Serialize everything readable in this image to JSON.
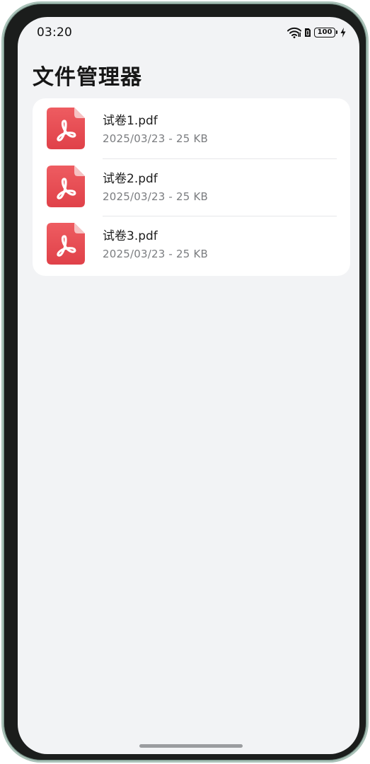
{
  "status_bar": {
    "time": "03:20",
    "battery_level": "100",
    "icons": [
      "wifi-icon",
      "sim-icon",
      "battery-icon",
      "charging-icon"
    ]
  },
  "app": {
    "title": "文件管理器"
  },
  "files": [
    {
      "name": "试卷1.pdf",
      "meta": "2025/03/23 - 25 KB",
      "icon": "pdf-file-icon"
    },
    {
      "name": "试卷2.pdf",
      "meta": "2025/03/23 - 25 KB",
      "icon": "pdf-file-icon"
    },
    {
      "name": "试卷3.pdf",
      "meta": "2025/03/23 - 25 KB",
      "icon": "pdf-file-icon"
    }
  ],
  "colors": {
    "background": "#f2f3f5",
    "card": "#ffffff",
    "pdf_red": "#e5484d",
    "pdf_fold": "#f3b5b6",
    "secondary_text": "#7b7d80"
  }
}
